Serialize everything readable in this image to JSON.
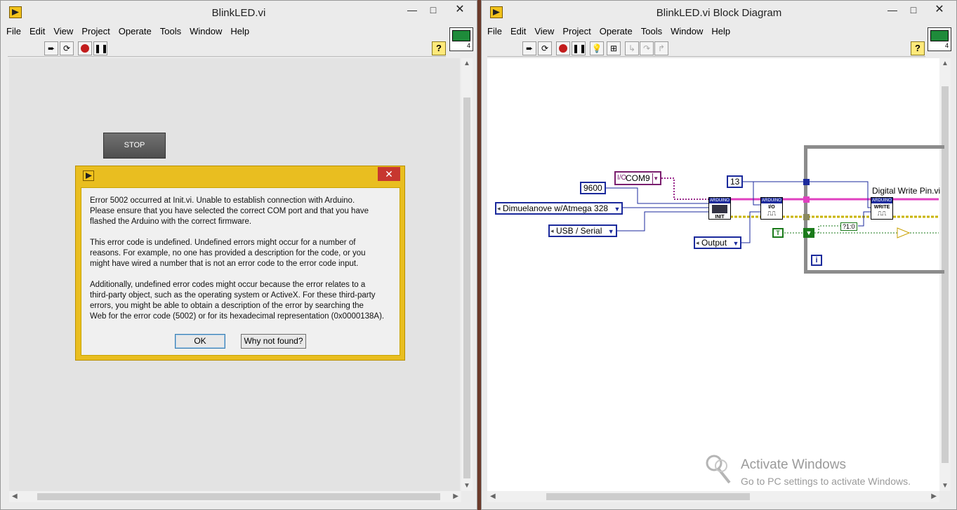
{
  "front_panel": {
    "title": "BlinkLED.vi",
    "menu": [
      "File",
      "Edit",
      "View",
      "Project",
      "Operate",
      "Tools",
      "Window",
      "Help"
    ],
    "window_controls": {
      "minimize": "—",
      "maximize": "□",
      "close": "✕"
    },
    "icon_number": "4",
    "help": "?",
    "stop_button": "STOP"
  },
  "dialog": {
    "close": "✕",
    "paragraphs": [
      "Error 5002 occurred at Init.vi.  Unable to establish connection with Arduino.\nPlease ensure that you have selected the correct COM port and that you have\nflashed the Arduino with the correct firmware.",
      "This error code is undefined. Undefined errors might occur for a number of\nreasons. For example, no one has provided a description for the code, or you\nmight have wired a number that is not an error code to the error code input.",
      "Additionally, undefined error codes might occur because the error relates to a\nthird-party object, such as the operating system or ActiveX. For these third-party\nerrors, you might be able to obtain a description of the error by searching the\nWeb for the error code (5002) or for its hexadecimal representation (0x0000138A)."
    ],
    "ok": "OK",
    "why": "Why not found?"
  },
  "block_diagram": {
    "title": "BlinkLED.vi Block Diagram",
    "menu": [
      "File",
      "Edit",
      "View",
      "Project",
      "Operate",
      "Tools",
      "Window",
      "Help"
    ],
    "icon_number": "4",
    "help": "?",
    "constants": {
      "com_port": "COM9",
      "baud": "9600",
      "board": "Dimuelanove w/Atmega 328",
      "connection": "USB / Serial",
      "pin": "13",
      "mode": "Output",
      "bool": "T",
      "iteration": "i",
      "conversion": "?1:0"
    },
    "subvis": {
      "init": "INIT",
      "io": "I/O",
      "write": "WRITE",
      "header": "ARDUINO"
    },
    "label_write": "Digital Write Pin.vi"
  },
  "watermark": {
    "line1": "Activate Windows",
    "line2": "Go to PC settings to activate Windows."
  },
  "colors": {
    "dialog_border": "#e9be20",
    "dialog_close": "#c7372f",
    "wire_visa": "#e040c0",
    "wire_error": "#c8b400",
    "wire_numeric": "#1b2a9c",
    "wire_bool": "#1a7a1a"
  }
}
